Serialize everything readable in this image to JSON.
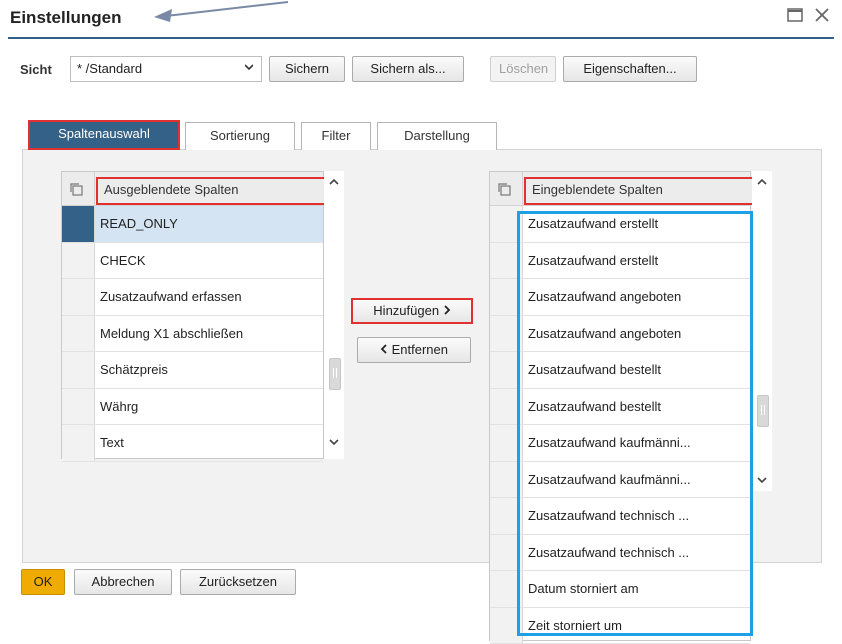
{
  "window": {
    "title": "Einstellungen",
    "maximize_icon": "maximize-icon",
    "close_icon": "close-icon"
  },
  "toolbar": {
    "view_label": "Sicht",
    "view_value": "* /Standard",
    "save_label": "Sichern",
    "save_as_label": "Sichern als...",
    "delete_label": "Löschen",
    "properties_label": "Eigenschaften..."
  },
  "tabs": [
    {
      "label": "Spaltenauswahl",
      "active": true
    },
    {
      "label": "Sortierung",
      "active": false
    },
    {
      "label": "Filter",
      "active": false
    },
    {
      "label": "Darstellung",
      "active": false
    }
  ],
  "hidden_columns": {
    "header": "Ausgeblendete Spalten",
    "items": [
      "READ_ONLY",
      "CHECK",
      "Zusatzaufwand erfassen",
      "Meldung X1 abschließen",
      "Schätzpreis",
      "Währg",
      "Text"
    ],
    "selected_index": 0
  },
  "visible_columns": {
    "header": "Eingeblendete Spalten",
    "items": [
      "Zusatzaufwand erstellt",
      "Zusatzaufwand erstellt",
      "Zusatzaufwand angeboten",
      "Zusatzaufwand angeboten",
      "Zusatzaufwand bestellt",
      "Zusatzaufwand bestellt",
      "Zusatzaufwand kaufmänni...",
      "Zusatzaufwand kaufmänni...",
      "Zusatzaufwand technisch ...",
      "Zusatzaufwand technisch ...",
      "Datum storniert am",
      "Zeit storniert um"
    ]
  },
  "actions": {
    "add_label": "Hinzufügen",
    "remove_label": "Entfernen"
  },
  "footer": {
    "ok_label": "OK",
    "cancel_label": "Abbrechen",
    "reset_label": "Zurücksetzen"
  },
  "colors": {
    "accent": "#346187",
    "highlight_red": "#e03030",
    "highlight_blue": "#1ea0e6",
    "ok": "#f0ab00"
  }
}
